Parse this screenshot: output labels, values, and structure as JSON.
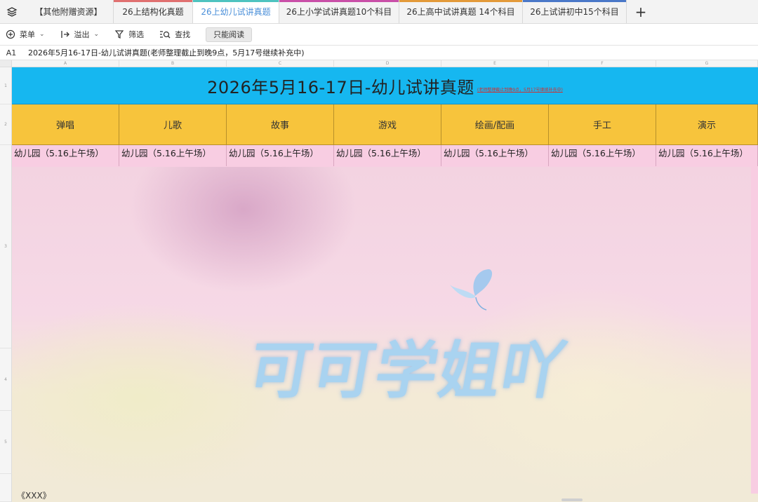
{
  "tabs": [
    {
      "label": "【其他附赠资源】",
      "color": "",
      "active": false
    },
    {
      "label": "26上结构化真题",
      "color": "#e07070",
      "active": false
    },
    {
      "label": "26上幼儿试讲真题",
      "color": "#4ec3c0",
      "active": true
    },
    {
      "label": "26上小学试讲真题10个科目",
      "color": "#c94fa8",
      "active": false
    },
    {
      "label": "26上高中试讲真题 14个科目",
      "color": "#e39a3a",
      "active": false
    },
    {
      "label": "26上试讲初中15个科目",
      "color": "#4a78c8",
      "active": false
    }
  ],
  "toolbar": {
    "menu": "菜单",
    "export": "溢出",
    "filter": "筛选",
    "find": "查找",
    "readonly": "只能阅读"
  },
  "formula_bar": {
    "cell_ref": "A1",
    "content": "2026年5月16-17日-幼儿试讲真题(老师整理截止到晚9点，5月17号继续补充中)"
  },
  "columns": [
    "A",
    "B",
    "C",
    "D",
    "E",
    "F",
    "G"
  ],
  "rows": [
    "1",
    "2",
    "3",
    "4",
    "5"
  ],
  "sheet": {
    "title": "2026年5月16-17日-幼儿试讲真题",
    "title_note": "(老师整理截止到晚9点，5月17号继续补充中)",
    "headers": [
      "弹唱",
      "儿歌",
      "故事",
      "游戏",
      "绘画/配画",
      "手工",
      "演示"
    ],
    "first_lines": [
      "幼儿园（5.16上午场）",
      "幼儿园（5.16上午场）",
      "幼儿园（5.16上午场）",
      "幼儿园（5.16上午场）",
      "幼儿园（5.16上午场）",
      "幼儿园（5.16上午场）",
      "幼儿园（5.16上午场）"
    ],
    "bottom_text": "《XXX》"
  },
  "watermark": "可可学姐吖",
  "colors": {
    "title_bg": "#16b7f0",
    "header_bg": "#f7c43c",
    "body_bg": "#f8cde2",
    "active_tab_text": "#4a8fd9"
  }
}
